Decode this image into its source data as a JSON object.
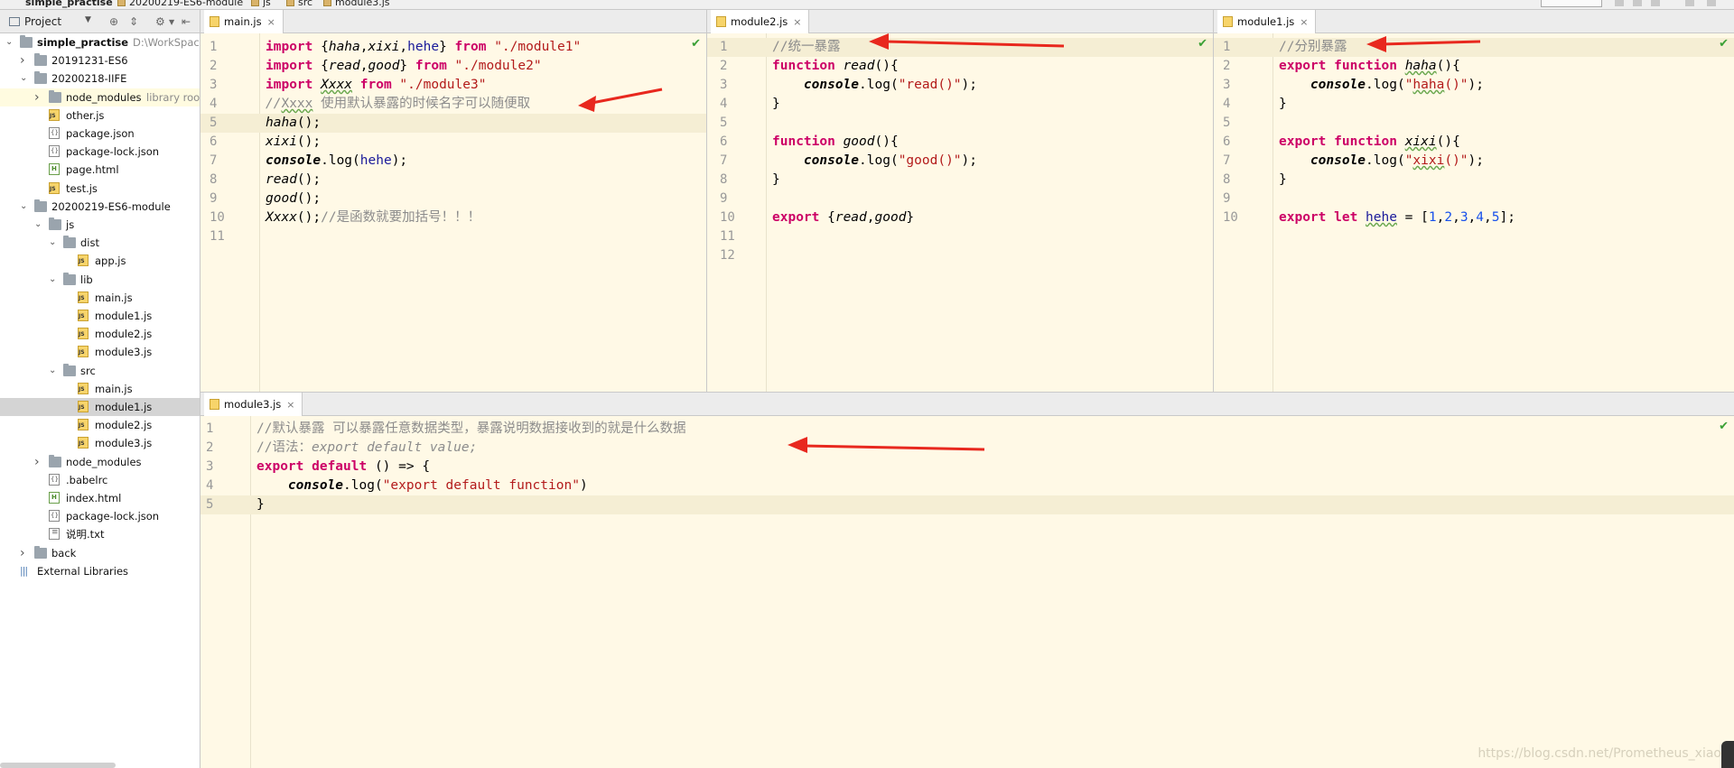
{
  "breadcrumbs": [
    "simple_practise",
    "20200219-ES6-module",
    "js",
    "src",
    "module3.js"
  ],
  "sidebar": {
    "header": {
      "view": "Project"
    },
    "tree": [
      {
        "label": "simple_practise",
        "bold": true,
        "hint": "D:\\WorkSpace\\we",
        "indent": 0,
        "arrow": "open",
        "icon": "folder"
      },
      {
        "label": "20191231-ES6",
        "indent": 1,
        "arrow": "closed",
        "icon": "folder"
      },
      {
        "label": "20200218-IIFE",
        "indent": 1,
        "arrow": "open",
        "icon": "folder"
      },
      {
        "label": "node_modules",
        "hint": "library root",
        "indent": 2,
        "arrow": "closed",
        "icon": "folder",
        "highlight": true
      },
      {
        "label": "other.js",
        "indent": 2,
        "icon": "js"
      },
      {
        "label": "package.json",
        "indent": 2,
        "icon": "json"
      },
      {
        "label": "package-lock.json",
        "indent": 2,
        "icon": "json"
      },
      {
        "label": "page.html",
        "indent": 2,
        "icon": "html"
      },
      {
        "label": "test.js",
        "indent": 2,
        "icon": "js"
      },
      {
        "label": "20200219-ES6-module",
        "indent": 1,
        "arrow": "open",
        "icon": "folder"
      },
      {
        "label": "js",
        "indent": 2,
        "arrow": "open",
        "icon": "folder"
      },
      {
        "label": "dist",
        "indent": 3,
        "arrow": "open",
        "icon": "folder"
      },
      {
        "label": "app.js",
        "indent": 4,
        "icon": "js"
      },
      {
        "label": "lib",
        "indent": 3,
        "arrow": "open",
        "icon": "folder"
      },
      {
        "label": "main.js",
        "indent": 4,
        "icon": "js"
      },
      {
        "label": "module1.js",
        "indent": 4,
        "icon": "js"
      },
      {
        "label": "module2.js",
        "indent": 4,
        "icon": "js"
      },
      {
        "label": "module3.js",
        "indent": 4,
        "icon": "js"
      },
      {
        "label": "src",
        "indent": 3,
        "arrow": "open",
        "icon": "folder"
      },
      {
        "label": "main.js",
        "indent": 4,
        "icon": "js"
      },
      {
        "label": "module1.js",
        "indent": 4,
        "icon": "js",
        "selected": true
      },
      {
        "label": "module2.js",
        "indent": 4,
        "icon": "js"
      },
      {
        "label": "module3.js",
        "indent": 4,
        "icon": "js"
      },
      {
        "label": "node_modules",
        "indent": 2,
        "arrow": "closed",
        "icon": "folder"
      },
      {
        "label": ".babelrc",
        "indent": 2,
        "icon": "json"
      },
      {
        "label": "index.html",
        "indent": 2,
        "icon": "html"
      },
      {
        "label": "package-lock.json",
        "indent": 2,
        "icon": "json"
      },
      {
        "label": "说明.txt",
        "indent": 2,
        "icon": "txt"
      },
      {
        "label": "back",
        "indent": 1,
        "arrow": "closed",
        "icon": "folder"
      },
      {
        "label": "External Libraries",
        "indent": 0,
        "icon": "lib"
      }
    ]
  },
  "editors": [
    {
      "tab": "main.js",
      "current_line": 5,
      "lines": [
        [
          [
            "import ",
            "kw"
          ],
          [
            "{",
            "p"
          ],
          [
            "haha",
            "i"
          ],
          [
            ",",
            "p"
          ],
          [
            "xixi",
            "i"
          ],
          [
            ",",
            "p"
          ],
          [
            "hehe",
            "v"
          ],
          [
            "} ",
            "p"
          ],
          [
            "from ",
            "kw"
          ],
          [
            "\"./module1\"",
            "s"
          ]
        ],
        [
          [
            "import ",
            "kw"
          ],
          [
            "{",
            "p"
          ],
          [
            "read",
            "i"
          ],
          [
            ",",
            "p"
          ],
          [
            "good",
            "i"
          ],
          [
            "} ",
            "p"
          ],
          [
            "from ",
            "kw"
          ],
          [
            "\"./module2\"",
            "s"
          ]
        ],
        [
          [
            "import ",
            "kw"
          ],
          [
            "Xxxx",
            "iu"
          ],
          [
            " ",
            "p"
          ],
          [
            "from ",
            "kw"
          ],
          [
            "\"./module3\"",
            "s"
          ]
        ],
        [
          [
            "//",
            "c"
          ],
          [
            "Xxxx",
            "cu"
          ],
          [
            " 使用默认暴露的时候名字可以随便取",
            "cz"
          ]
        ],
        [
          [
            "haha",
            "i"
          ],
          [
            "();",
            "p"
          ]
        ],
        [
          [
            "xixi",
            "i"
          ],
          [
            "();",
            "p"
          ]
        ],
        [
          [
            "console",
            "ib"
          ],
          [
            ".log(",
            "p"
          ],
          [
            "hehe",
            "v"
          ],
          [
            ");",
            "p"
          ]
        ],
        [
          [
            "read",
            "i"
          ],
          [
            "();",
            "p"
          ]
        ],
        [
          [
            "good",
            "i"
          ],
          [
            "();",
            "p"
          ]
        ],
        [
          [
            "Xxxx",
            "i"
          ],
          [
            "();",
            "p"
          ],
          [
            "//是函数就要加括号！！！",
            "cz"
          ]
        ],
        []
      ]
    },
    {
      "tab": "module2.js",
      "current_line": 1,
      "lines": [
        [
          [
            "//统一暴露",
            "cz"
          ]
        ],
        [
          [
            "function ",
            "kw"
          ],
          [
            "read",
            "i"
          ],
          [
            "(){",
            "p"
          ]
        ],
        [
          [
            "    ",
            "p"
          ],
          [
            "console",
            "ib"
          ],
          [
            ".log(",
            "p"
          ],
          [
            "\"read()\"",
            "s"
          ],
          [
            ");",
            "p"
          ]
        ],
        [
          [
            "}",
            "p"
          ]
        ],
        [],
        [
          [
            "function ",
            "kw"
          ],
          [
            "good",
            "i"
          ],
          [
            "(){",
            "p"
          ]
        ],
        [
          [
            "    ",
            "p"
          ],
          [
            "console",
            "ib"
          ],
          [
            ".log(",
            "p"
          ],
          [
            "\"good()\"",
            "s"
          ],
          [
            ");",
            "p"
          ]
        ],
        [
          [
            "}",
            "p"
          ]
        ],
        [],
        [
          [
            "export ",
            "kw"
          ],
          [
            "{",
            "p"
          ],
          [
            "read",
            "i"
          ],
          [
            ",",
            "p"
          ],
          [
            "good",
            "i"
          ],
          [
            "}",
            "p"
          ]
        ],
        [],
        []
      ]
    },
    {
      "tab": "module1.js",
      "current_line": 1,
      "lines": [
        [
          [
            "//分别暴露",
            "cz"
          ]
        ],
        [
          [
            "export ",
            "kw"
          ],
          [
            "function ",
            "kw"
          ],
          [
            "haha",
            "iu"
          ],
          [
            "(){",
            "p"
          ]
        ],
        [
          [
            "    ",
            "p"
          ],
          [
            "console",
            "ib"
          ],
          [
            ".log(",
            "p"
          ],
          [
            "\"",
            "s"
          ],
          [
            "haha",
            "su"
          ],
          [
            "()\"",
            "s"
          ],
          [
            ");",
            "p"
          ]
        ],
        [
          [
            "}",
            "p"
          ]
        ],
        [],
        [
          [
            "export ",
            "kw"
          ],
          [
            "function ",
            "kw"
          ],
          [
            "xixi",
            "iu"
          ],
          [
            "(){",
            "p"
          ]
        ],
        [
          [
            "    ",
            "p"
          ],
          [
            "console",
            "ib"
          ],
          [
            ".log(",
            "p"
          ],
          [
            "\"",
            "s"
          ],
          [
            "xixi",
            "su"
          ],
          [
            "()\"",
            "s"
          ],
          [
            ");",
            "p"
          ]
        ],
        [
          [
            "}",
            "p"
          ]
        ],
        [],
        [
          [
            "export ",
            "kw"
          ],
          [
            "let ",
            "kw"
          ],
          [
            "hehe",
            "vu"
          ],
          [
            " = [",
            "p"
          ],
          [
            "1",
            "n"
          ],
          [
            ",",
            "p"
          ],
          [
            "2",
            "n"
          ],
          [
            ",",
            "p"
          ],
          [
            "3",
            "n"
          ],
          [
            ",",
            "p"
          ],
          [
            "4",
            "n"
          ],
          [
            ",",
            "p"
          ],
          [
            "5",
            "n"
          ],
          [
            "];",
            "p"
          ]
        ]
      ]
    },
    {
      "tab": "module3.js",
      "current_line": 5,
      "lines": [
        [
          [
            "//默认暴露 可以暴露任意数据类型，暴露说明数据接收到的就是什么数据",
            "cz"
          ]
        ],
        [
          [
            "//语法：",
            "cz"
          ],
          [
            "export default value;",
            "c"
          ]
        ],
        [
          [
            "export ",
            "kw"
          ],
          [
            "default ",
            "kw"
          ],
          [
            "() => ",
            "p"
          ],
          [
            "{",
            "p"
          ]
        ],
        [
          [
            "    ",
            "p"
          ],
          [
            "console",
            "ib"
          ],
          [
            ".log(",
            "p"
          ],
          [
            "\"export default function\"",
            "s"
          ],
          [
            ")",
            "p"
          ]
        ],
        [
          [
            "}",
            "p"
          ]
        ]
      ]
    }
  ],
  "watermark": "https://blog.csdn.net/Prometheus_xiao",
  "colors": {
    "editor_bg": "#fff9e6",
    "keyword": "#cc0066",
    "string": "#b31b1b",
    "comment": "#8c8c8c",
    "annotation_arrow": "#e8281e"
  }
}
